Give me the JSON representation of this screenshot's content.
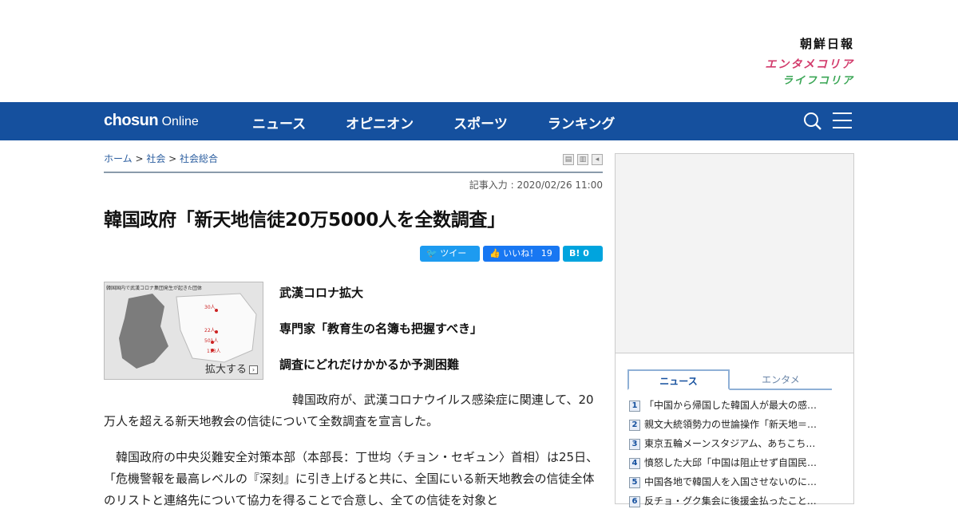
{
  "brands": {
    "main": "朝鮮日報",
    "entame": "エンタメコリア",
    "life": "ライフコリア"
  },
  "nav": {
    "logo_bold": "chosun",
    "logo_light": " Online",
    "items": [
      "ニュース",
      "オピニオン",
      "スポーツ",
      "ランキング"
    ],
    "search_icon": "search-icon",
    "menu_icon": "hamburger-icon"
  },
  "breadcrumb": {
    "home": "ホーム",
    "section": "社会",
    "subsection": "社会総合",
    "sep": " > "
  },
  "article": {
    "date": "記事入力 : 2020/02/26 11:00",
    "title": "韓国政府「新天地信徒20万5000人を全数調査」",
    "social": {
      "tweet": "ツイート",
      "like": "いいね！ 19",
      "hatena": "B! 0"
    },
    "photo": {
      "caption": "韓国国内で武漢コロナ集団発生が起きた団体",
      "enlarge": "拡大する"
    },
    "subheads": [
      "武漢コロナ拡大",
      "専門家「教育生の名簿も把握すべき」",
      "調査にどれだけかかるか予測困難"
    ],
    "para1": "韓国政府が、武漢コロナウイルス感染症に関連して、20万人を超える新天地教会の信徒について全数調査を宣言した。",
    "para2": "韓国政府の中央災難安全対策本部（本部長：丁世均〈チョン・セギュン〉首相）は25日、「危機警報を最高レベルの『深刻』に引き上げると共に、全国にいる新天地教会の信徒全体のリストと連絡先について協力を得ることで合意し、全ての信徒を対象と"
  },
  "sidebar": {
    "tabs": [
      "ニュース",
      "エンタメ"
    ],
    "ranking": [
      "「中国から帰国した韓国人が最大の感…",
      "親文大統領勢力の世論操作「新天地＝…",
      "東京五輪メーンスタジアム、あちこち…",
      "憤怒した大邱「中国は阻止せず自国民…",
      "中国各地で韓国人を入国させないのに…",
      "反チョ・グク集会に後援金払ったこと…"
    ]
  }
}
